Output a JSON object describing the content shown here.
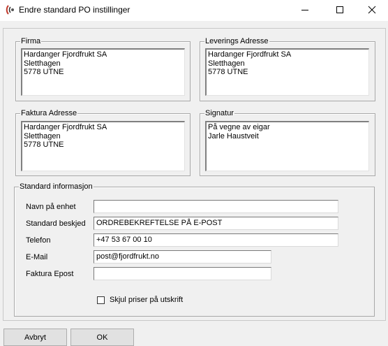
{
  "window": {
    "title": "Endre standard PO instillinger"
  },
  "groups": {
    "firma": {
      "label": "Firma",
      "lines": [
        "Hardanger Fjordfrukt SA",
        "Sletthagen",
        "5778 UTNE"
      ]
    },
    "levering": {
      "label": "Leverings Adresse",
      "lines": [
        "Hardanger Fjordfrukt SA",
        "Sletthagen",
        "5778 UTNE"
      ]
    },
    "faktura": {
      "label": "Faktura Adresse",
      "lines": [
        "Hardanger Fjordfrukt SA",
        "Sletthagen",
        "5778 UTNE"
      ]
    },
    "signatur": {
      "label": "Signatur",
      "lines": [
        "På vegne av eigar",
        "Jarle Haustveit"
      ]
    }
  },
  "standard": {
    "label": "Standard informasjon",
    "fields": {
      "navn": {
        "label": "Navn på enhet",
        "value": ""
      },
      "beskjed": {
        "label": "Standard beskjed",
        "value": "ORDREBEKREFTELSE PÅ  E-POST"
      },
      "telefon": {
        "label": "Telefon",
        "value": "+47 53 67 00 10"
      },
      "email": {
        "label": "E-Mail",
        "value": "post@fjordfrukt.no"
      },
      "faktura_epost": {
        "label": "Faktura Epost",
        "value": ""
      }
    },
    "hide_prices": {
      "label": "Skjul priser på utskrift",
      "checked": false
    }
  },
  "buttons": {
    "cancel": "Avbryt",
    "ok": "OK"
  },
  "icons": {
    "app": "app-icon",
    "minimize": "minimize-icon",
    "maximize": "maximize-icon",
    "close": "close-icon"
  }
}
